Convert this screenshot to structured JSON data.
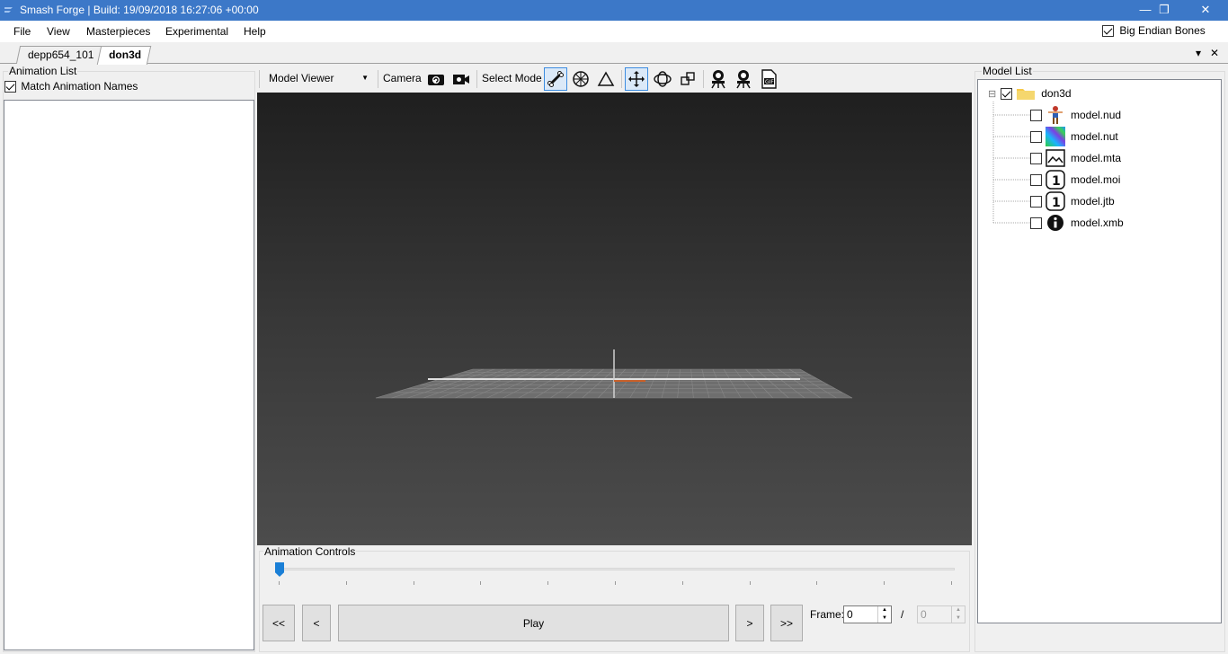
{
  "window": {
    "title": "Smash Forge | Build: 19/09/2018 16:27:06 +00:00",
    "minimize": "—",
    "restore": "❐",
    "close": "✕"
  },
  "menu": {
    "items": [
      "File",
      "View",
      "Masterpieces",
      "Experimental",
      "Help"
    ],
    "big_endian_label": "Big Endian Bones",
    "big_endian_checked": true
  },
  "tabs": {
    "items": [
      "depp654_101",
      "don3d"
    ],
    "active": "don3d",
    "dropdown": "▾",
    "close": "✕"
  },
  "animation_list": {
    "group_label": "Animation List",
    "match_label": "Match Animation Names",
    "match_checked": true
  },
  "toolbar": {
    "view_select": "Model Viewer",
    "camera_label": "Camera",
    "select_mode_label": "Select Mode"
  },
  "anim_controls": {
    "group_label": "Animation Controls",
    "first": "<<",
    "prev": "<",
    "play": "Play",
    "next": ">",
    "last": ">>",
    "frame_label": "Frame:",
    "frame_value": "0",
    "slash": "/",
    "total_value": "0",
    "slider_position": 0
  },
  "model_list": {
    "group_label": "Model List",
    "root": {
      "name": "don3d",
      "checked": true,
      "expander": "⊟"
    },
    "children": [
      {
        "name": "model.nud",
        "icon": "character-icon"
      },
      {
        "name": "model.nut",
        "icon": "texture-icon"
      },
      {
        "name": "model.mta",
        "icon": "image-icon"
      },
      {
        "name": "model.moi",
        "icon": "number-one-icon"
      },
      {
        "name": "model.jtb",
        "icon": "number-one-icon"
      },
      {
        "name": "model.xmb",
        "icon": "info-icon"
      }
    ]
  }
}
